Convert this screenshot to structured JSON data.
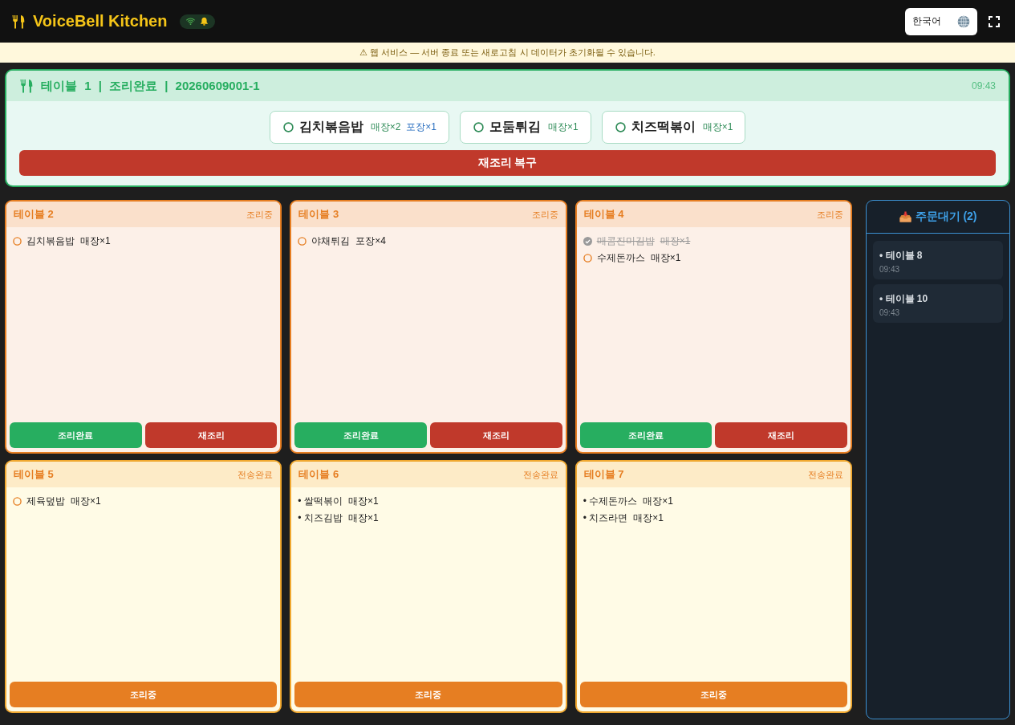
{
  "header": {
    "title": "VoiceBell Kitchen",
    "language": "한국어"
  },
  "banner": "⚠ 웹 서비스 — 서버 종료 또는 새로고침 시 데이터가 초기화될 수 있습니다.",
  "featured": {
    "title": "테이블 1 | 조리완료 | 20260609001-1",
    "time": "09:43",
    "items": [
      {
        "name": "김치볶음밥",
        "checked": false,
        "tags": [
          {
            "label": "매장×2",
            "kind": "dine_in"
          },
          {
            "label": "포장×1",
            "kind": "takeout"
          }
        ]
      },
      {
        "name": "모둠튀김",
        "checked": false,
        "tags": [
          {
            "label": "매장×1",
            "kind": "dine_in"
          }
        ]
      },
      {
        "name": "치즈떡볶이",
        "checked": false,
        "tags": [
          {
            "label": "매장×1",
            "kind": "dine_in"
          }
        ]
      }
    ],
    "button": {
      "label": "재조리 복구",
      "kind": "recook"
    }
  },
  "cards": [
    {
      "table": "테이블 2",
      "status": "조리중",
      "kind": "cooking",
      "items": [
        {
          "kind": "check",
          "checked": false,
          "name": "김치볶음밥",
          "qty": "매장×1"
        }
      ],
      "buttons": [
        {
          "label": "조리완료",
          "kind": "complete"
        },
        {
          "label": "재조리",
          "kind": "recook"
        }
      ]
    },
    {
      "table": "테이블 3",
      "status": "조리중",
      "kind": "cooking",
      "items": [
        {
          "kind": "check",
          "checked": false,
          "name": "야채튀김",
          "qty": "포장×4"
        }
      ],
      "buttons": [
        {
          "label": "조리완료",
          "kind": "complete"
        },
        {
          "label": "재조리",
          "kind": "recook"
        }
      ]
    },
    {
      "table": "테이블 4",
      "status": "조리중",
      "kind": "cooking",
      "items": [
        {
          "kind": "check",
          "checked": true,
          "name": "매콤진미김밥",
          "qty": "매장×1"
        },
        {
          "kind": "check",
          "checked": false,
          "name": "수제돈까스",
          "qty": "매장×1"
        }
      ],
      "buttons": [
        {
          "label": "조리완료",
          "kind": "complete"
        },
        {
          "label": "재조리",
          "kind": "recook"
        }
      ]
    },
    {
      "table": "테이블 5",
      "status": "전송완료",
      "kind": "sent",
      "items": [
        {
          "kind": "check",
          "checked": false,
          "name": "제육덮밥",
          "qty": "매장×1"
        }
      ],
      "buttons": [
        {
          "label": "조리중",
          "kind": "cooking"
        }
      ]
    },
    {
      "table": "테이블 6",
      "status": "전송완료",
      "kind": "sent",
      "items": [
        {
          "kind": "bullet",
          "name": "• 쌀떡볶이",
          "qty": "매장×1"
        },
        {
          "kind": "bullet",
          "name": "• 치즈김밥",
          "qty": "매장×1"
        }
      ],
      "buttons": [
        {
          "label": "조리중",
          "kind": "cooking"
        }
      ]
    },
    {
      "table": "테이블 7",
      "status": "전송완료",
      "kind": "sent",
      "items": [
        {
          "kind": "bullet",
          "name": "• 수제돈까스",
          "qty": "매장×1"
        },
        {
          "kind": "bullet",
          "name": "• 치즈라면",
          "qty": "매장×1"
        }
      ],
      "buttons": [
        {
          "label": "조리중",
          "kind": "cooking"
        }
      ]
    }
  ],
  "queue": {
    "title": "주문대기 (2)",
    "items": [
      {
        "label": "• 테이블 8",
        "time": "09:43"
      },
      {
        "label": "• 테이블 10",
        "time": "09:43"
      }
    ]
  }
}
